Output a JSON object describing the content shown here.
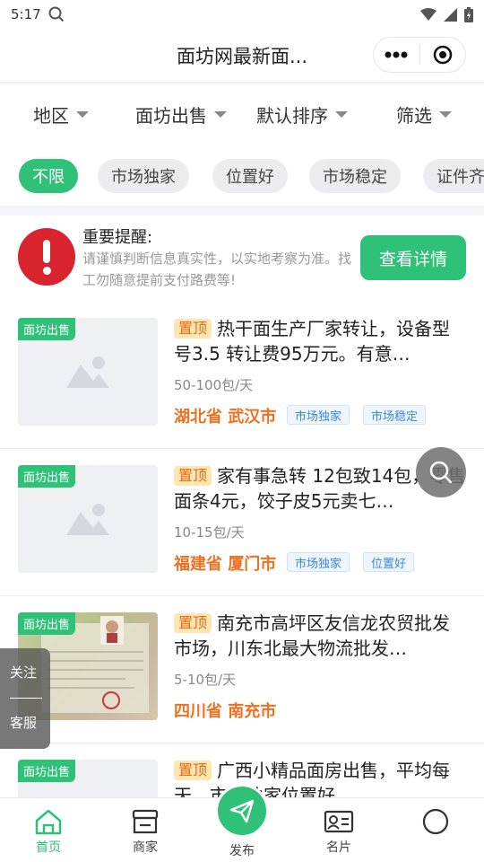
{
  "status_bar": {
    "time": "5:17"
  },
  "header": {
    "title": "面坊网最新面..."
  },
  "filters": [
    {
      "label": "地区"
    },
    {
      "label": "面坊出售"
    },
    {
      "label": "默认排序"
    },
    {
      "label": "筛选"
    }
  ],
  "tags": [
    "不限",
    "市场独家",
    "位置好",
    "市场稳定",
    "证件齐"
  ],
  "notice": {
    "title": "重要提醒:",
    "text": "请谨慎判断信息真实性，以实地考察为准。找工勿随意提前支付路费等!",
    "button": "查看详情"
  },
  "listings": [
    {
      "category": "面坊出售",
      "top_label": "置顶",
      "title": "热干面生产厂家转让，设备型号3.5 转让费95万元。有意…",
      "spec": "50-100包/天",
      "location": "湖北省 武汉市",
      "tags": [
        "市场独家",
        "市场稳定"
      ]
    },
    {
      "category": "面坊出售",
      "top_label": "置顶",
      "title": "家有事急转 12包致14包，零售面条4元，饺子皮5元卖七…",
      "spec": "10-15包/天",
      "location": "福建省 厦门市",
      "tags": [
        "市场独家",
        "位置好"
      ]
    },
    {
      "category": "面坊出售",
      "top_label": "置顶",
      "title": "南充市高坪区友信龙农贸批发市场，川东北最大物流批发…",
      "spec": "5-10包/天",
      "location": "四川省 南充市",
      "tags": []
    },
    {
      "category": "面坊出售",
      "top_label": "置顶",
      "title": "广西小精品面房出售，平均每天…市场独家位置好…",
      "spec": "",
      "location": "",
      "tags": []
    }
  ],
  "float_left": {
    "follow": "关注",
    "service": "客服"
  },
  "bottom_nav": {
    "home": "首页",
    "merchant": "商家",
    "publish": "发布",
    "card": "名片",
    "mine": ""
  },
  "colors": {
    "accent": "#2fc178",
    "alert": "#d9242f",
    "location": "#f07020",
    "top_badge_bg": "#fde6b2"
  }
}
